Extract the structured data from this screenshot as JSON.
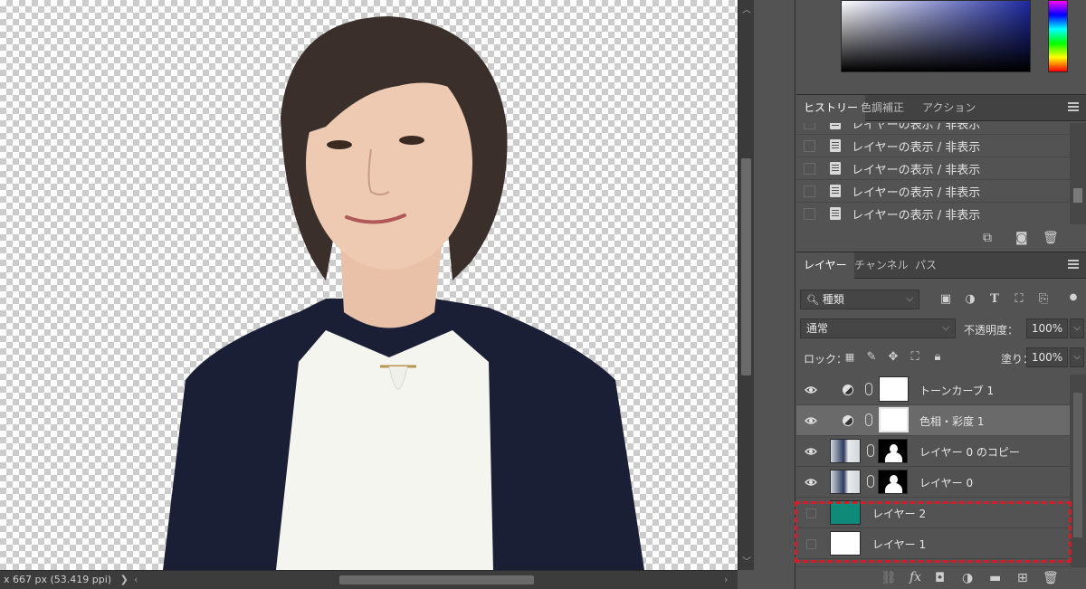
{
  "status": {
    "doc_info": "x 667 px (53.419 ppi)",
    "chevron": "❯",
    "left_arrow": "‹",
    "right_arrow": "›"
  },
  "panels": {
    "history_tabs": [
      "ヒストリー",
      "色調補正",
      "アクション"
    ],
    "history_items": [
      "レイヤーの表示 / 非表示",
      "レイヤーの表示 / 非表示",
      "レイヤーの表示 / 非表示",
      "レイヤーの表示 / 非表示",
      "レイヤーの表示 / 非表示"
    ],
    "layers_tabs": [
      "レイヤー",
      "チャンネル",
      "パス"
    ]
  },
  "layers": {
    "filter_label": "種類",
    "blend_mode": "通常",
    "opacity_label": "不透明度：",
    "opacity_value": "100%",
    "lock_label": "ロック：",
    "fill_label": "塗り：",
    "fill_value": "100%",
    "items": [
      {
        "name": "トーンカーブ 1",
        "visible": true,
        "type": "adjustment"
      },
      {
        "name": "色相・彩度 1",
        "visible": true,
        "type": "adjustment",
        "selected": true
      },
      {
        "name": "レイヤー 0 のコピー",
        "visible": true,
        "type": "photo-mask"
      },
      {
        "name": "レイヤー 0",
        "visible": true,
        "type": "photo-mask"
      },
      {
        "name": "レイヤー 2",
        "visible": false,
        "type": "fill",
        "color": "#0f8a78"
      },
      {
        "name": "レイヤー 1",
        "visible": false,
        "type": "fill",
        "color": "#ffffff"
      }
    ]
  },
  "colors": {
    "highlight": "#d01f2a",
    "panel_bg": "#535353"
  }
}
